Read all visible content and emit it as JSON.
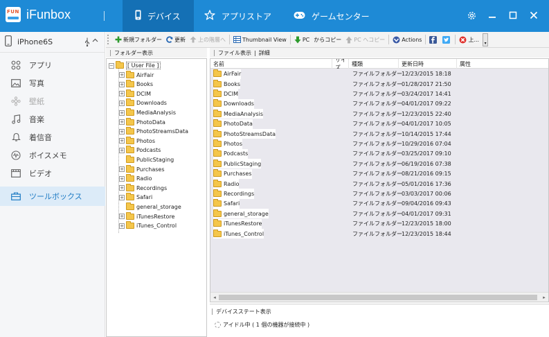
{
  "app": {
    "title": "iFunbox",
    "logo_text": "FUN"
  },
  "tabs": [
    {
      "label": "デバイス",
      "icon": "phone-icon",
      "active": true
    },
    {
      "label": "アプリストア",
      "icon": "star-icon",
      "active": false
    },
    {
      "label": "ゲームセンター",
      "icon": "gamepad-icon",
      "active": false
    }
  ],
  "window_controls": {
    "settings": "gear-icon",
    "minimize": "minimize-icon",
    "maximize": "maximize-icon",
    "close": "close-icon"
  },
  "sidebar": {
    "device_name": "iPhone6S",
    "items": [
      {
        "label": "アプリ",
        "icon": "apps-icon",
        "state": "normal"
      },
      {
        "label": "写真",
        "icon": "photo-icon",
        "state": "normal"
      },
      {
        "label": "壁紙",
        "icon": "wallpaper-icon",
        "state": "disabled"
      },
      {
        "label": "音楽",
        "icon": "music-icon",
        "state": "normal"
      },
      {
        "label": "着信音",
        "icon": "bell-icon",
        "state": "normal"
      },
      {
        "label": "ボイスメモ",
        "icon": "voice-memo-icon",
        "state": "normal"
      },
      {
        "label": "ビデオ",
        "icon": "video-icon",
        "state": "normal"
      },
      {
        "label": "ツールボックス",
        "icon": "toolbox-icon",
        "state": "active"
      }
    ]
  },
  "toolbar": {
    "new_folder": "新規フォルダー",
    "refresh": "更新",
    "up_level": "上の階層へ",
    "thumbnail_view": "Thumbnail View",
    "to_pc": "PC",
    "copy_from": "からコピー",
    "pc_to": "PC へコピー",
    "actions": "Actions",
    "delete": "上..."
  },
  "folder_pane": {
    "header": "フォルダー表示",
    "root": "[ User File ]",
    "folders": [
      {
        "name": "AirFair",
        "expandable": true
      },
      {
        "name": "Books",
        "expandable": true
      },
      {
        "name": "DCIM",
        "expandable": true
      },
      {
        "name": "Downloads",
        "expandable": true
      },
      {
        "name": "MediaAnalysis",
        "expandable": true
      },
      {
        "name": "PhotoData",
        "expandable": true
      },
      {
        "name": "PhotoStreamsData",
        "expandable": true
      },
      {
        "name": "Photos",
        "expandable": true
      },
      {
        "name": "Podcasts",
        "expandable": true
      },
      {
        "name": "PublicStaging",
        "expandable": false
      },
      {
        "name": "Purchases",
        "expandable": true
      },
      {
        "name": "Radio",
        "expandable": true
      },
      {
        "name": "Recordings",
        "expandable": true
      },
      {
        "name": "Safari",
        "expandable": true
      },
      {
        "name": "general_storage",
        "expandable": false
      },
      {
        "name": "iTunesRestore",
        "expandable": true
      },
      {
        "name": "iTunes_Control",
        "expandable": true
      }
    ]
  },
  "file_pane": {
    "header": "ファイル表示",
    "header_sep": "|",
    "header_detail": "詳細",
    "columns": [
      "名前",
      "サイズ",
      "種類",
      "更新日時",
      "属性"
    ],
    "rows": [
      {
        "name": "AirFair",
        "size": "",
        "type": "ファイルフォルダー",
        "date": "12/23/2015 18:18",
        "attr": ""
      },
      {
        "name": "Books",
        "size": "",
        "type": "ファイルフォルダー",
        "date": "01/28/2017 21:50",
        "attr": ""
      },
      {
        "name": "DCIM",
        "size": "",
        "type": "ファイルフォルダー",
        "date": "03/24/2017 14:41",
        "attr": ""
      },
      {
        "name": "Downloads",
        "size": "",
        "type": "ファイルフォルダー",
        "date": "04/01/2017 09:22",
        "attr": ""
      },
      {
        "name": "MediaAnalysis",
        "size": "",
        "type": "ファイルフォルダー",
        "date": "12/23/2015 22:40",
        "attr": ""
      },
      {
        "name": "PhotoData",
        "size": "",
        "type": "ファイルフォルダー",
        "date": "04/01/2017 10:05",
        "attr": ""
      },
      {
        "name": "PhotoStreamsData",
        "size": "",
        "type": "ファイルフォルダー",
        "date": "10/14/2015 17:44",
        "attr": ""
      },
      {
        "name": "Photos",
        "size": "",
        "type": "ファイルフォルダー",
        "date": "10/29/2016 07:04",
        "attr": ""
      },
      {
        "name": "Podcasts",
        "size": "",
        "type": "ファイルフォルダー",
        "date": "03/25/2017 09:10",
        "attr": ""
      },
      {
        "name": "PublicStaging",
        "size": "",
        "type": "ファイルフォルダー",
        "date": "06/19/2016 07:38",
        "attr": ""
      },
      {
        "name": "Purchases",
        "size": "",
        "type": "ファイルフォルダー",
        "date": "08/21/2016 09:15",
        "attr": ""
      },
      {
        "name": "Radio",
        "size": "",
        "type": "ファイルフォルダー",
        "date": "05/01/2016 17:36",
        "attr": ""
      },
      {
        "name": "Recordings",
        "size": "",
        "type": "ファイルフォルダー",
        "date": "03/03/2017 00:06",
        "attr": ""
      },
      {
        "name": "Safari",
        "size": "",
        "type": "ファイルフォルダー",
        "date": "09/04/2016 09:43",
        "attr": ""
      },
      {
        "name": "general_storage",
        "size": "",
        "type": "ファイルフォルダー",
        "date": "04/01/2017 09:31",
        "attr": ""
      },
      {
        "name": "iTunesRestore",
        "size": "",
        "type": "ファイルフォルダー",
        "date": "12/23/2015 18:00",
        "attr": ""
      },
      {
        "name": "iTunes_Control",
        "size": "",
        "type": "ファイルフォルダー",
        "date": "12/23/2015 18:44",
        "attr": ""
      }
    ]
  },
  "status": {
    "header": "デバイスステート表示",
    "text": "アイドル中 ( 1 個の機器が接続中 )"
  },
  "colors": {
    "titlebar": "#1e8ad6",
    "active_tab": "#1470b5",
    "sidebar_active_bg": "#dcebf8",
    "accent": "#1e7bc4"
  }
}
